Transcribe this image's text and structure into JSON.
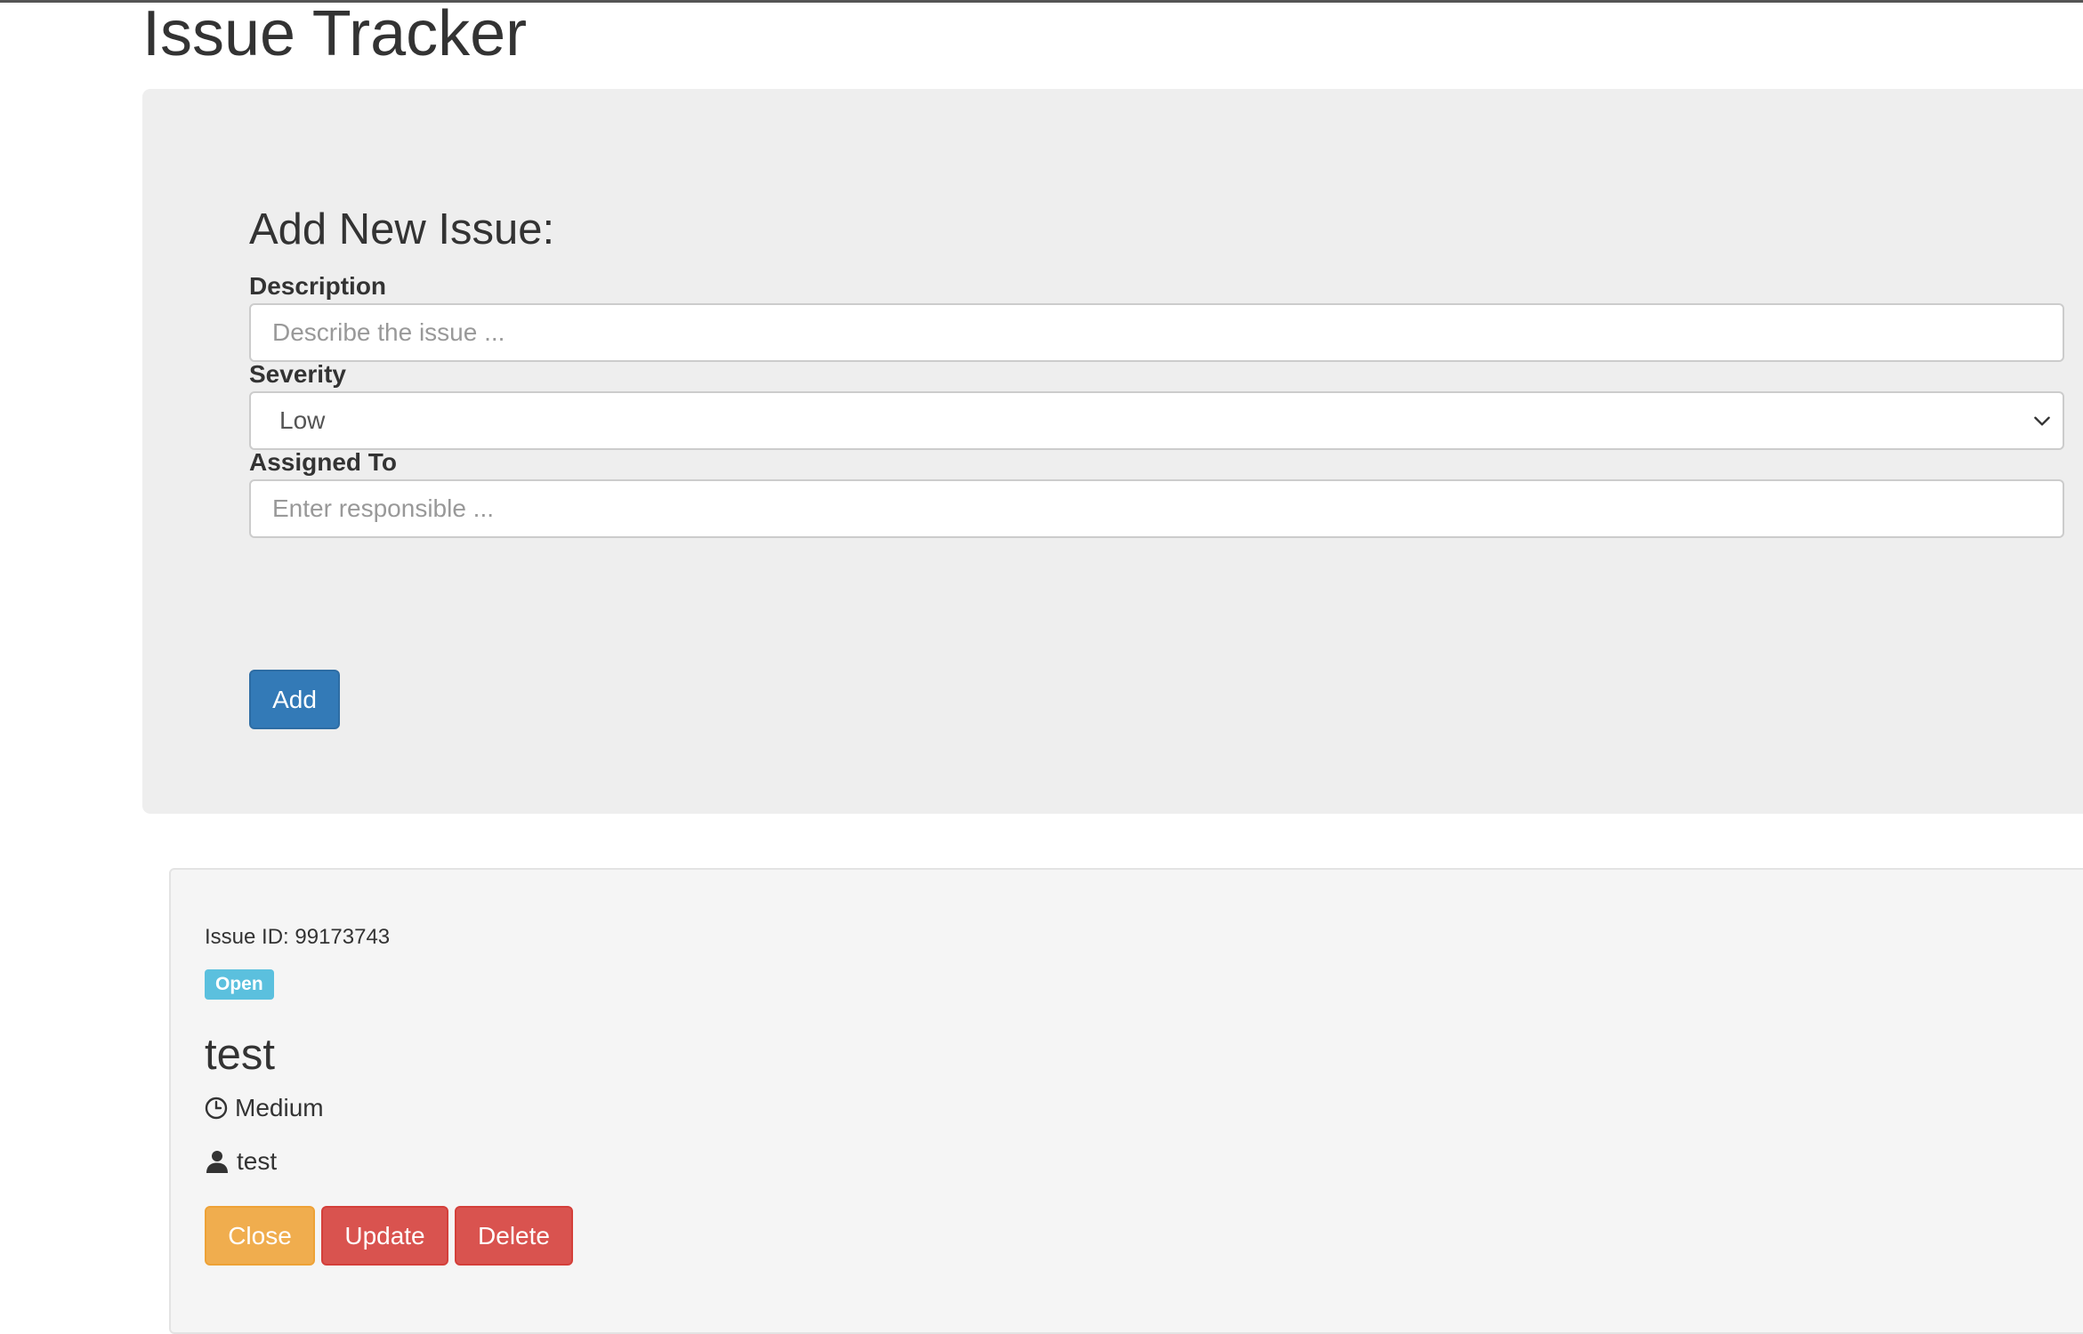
{
  "header": {
    "title": "Issue Tracker"
  },
  "form": {
    "heading": "Add New Issue:",
    "description_label": "Description",
    "description_placeholder": "Describe the issue ...",
    "severity_label": "Severity",
    "severity_value": "Low",
    "assigned_label": "Assigned To",
    "assigned_placeholder": "Enter responsible ...",
    "add_button": "Add"
  },
  "issue": {
    "id_text": "Issue ID: 99173743",
    "status": "Open",
    "title": "test",
    "severity": "Medium",
    "assignee": "test",
    "close_button": "Close",
    "update_button": "Update",
    "delete_button": "Delete",
    "severity_icon": "clock-icon",
    "assignee_icon": "user-icon"
  },
  "colors": {
    "primary": "#337ab7",
    "warning": "#f0ad4e",
    "danger": "#d9534f",
    "info": "#5bc0de"
  }
}
